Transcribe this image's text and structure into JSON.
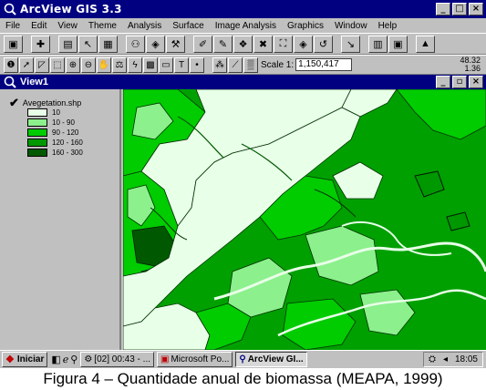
{
  "app": {
    "title": "ArcView GIS 3.3"
  },
  "menu": [
    "File",
    "Edit",
    "View",
    "Theme",
    "Analysis",
    "Surface",
    "Image Analysis",
    "Graphics",
    "Window",
    "Help"
  ],
  "scale": {
    "label": "Scale 1:",
    "value": "1,150,417"
  },
  "coords": {
    "x": "48.32",
    "y": "1.36"
  },
  "view": {
    "title": "View1"
  },
  "theme": {
    "name": "Avegetation.shp",
    "classes": [
      {
        "label": "10",
        "color": "#e8ffe8"
      },
      {
        "label": "10 - 90",
        "color": "#8cf08c"
      },
      {
        "label": "90 - 120",
        "color": "#00cc00"
      },
      {
        "label": "120 - 160",
        "color": "#009800"
      },
      {
        "label": "160 - 300",
        "color": "#005800"
      }
    ]
  },
  "taskbar": {
    "start": "Iniciar",
    "tasks": [
      "[02] 00:43 - ...",
      "Microsoft Po...",
      "ArcView GI..."
    ],
    "clock": "18:05"
  },
  "caption": "Figura 4 – Quantidade anual de biomassa (MEAPA, 1999)"
}
